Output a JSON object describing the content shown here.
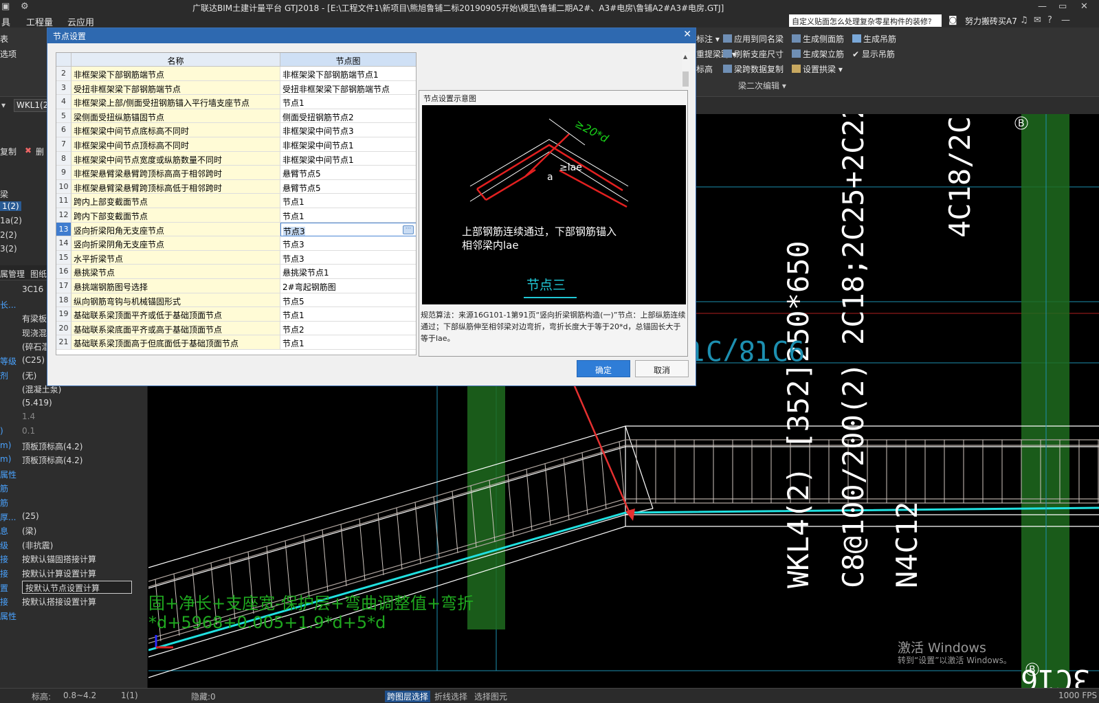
{
  "titlebar": {
    "title": "广联达BIM土建计量平台 GTJ2018 - [E:\\工程文件1\\新项目\\熊旭鲁铺二标20190905开始\\模型\\鲁铺二期A2#、A3#电房\\鲁铺A2#A3#电房.GTJ]"
  },
  "menubar": {
    "items": [
      "具",
      "工程量",
      "云应用"
    ],
    "search_text": "自定义贴面怎么处理复杂零星构件的装修?",
    "user": "努力搬砖买A7"
  },
  "ribbon": {
    "items": [
      {
        "label": "标注"
      },
      {
        "label": "应用到同名梁"
      },
      {
        "label": "生成侧面筋"
      },
      {
        "label": "生成吊筋"
      },
      {
        "label": "重提梁跨"
      },
      {
        "label": "刷新支座尺寸"
      },
      {
        "label": "生成架立筋"
      },
      {
        "label": "显示吊筋"
      },
      {
        "label": "标高"
      },
      {
        "label": "梁跨数据复制"
      },
      {
        "label": "设置拱梁"
      }
    ],
    "group_label": "梁二次编辑",
    "left_items": [
      "表",
      "选项"
    ]
  },
  "subbar": {
    "combo_value": "WKL1(2)",
    "copy_label": "复制",
    "delete_label": "删"
  },
  "leftpanel": {
    "tree": [
      {
        "label": "梁"
      },
      {
        "label": "1(2)"
      },
      {
        "label": "1a(2)"
      },
      {
        "label": "2(2)"
      },
      {
        "label": "3(2)"
      }
    ],
    "tabs": [
      "属管理",
      "图纸"
    ],
    "props": [
      {
        "key": "",
        "value": "3C16"
      },
      {
        "key": "长...",
        "value": ""
      },
      {
        "key": "",
        "value": "有梁板"
      },
      {
        "key": "",
        "value": "现浇混"
      },
      {
        "key": "",
        "value": "(碎石混"
      },
      {
        "key": "等级",
        "value": "(C25)"
      },
      {
        "key": "剂",
        "value": "(无)"
      },
      {
        "key": "",
        "value": "(混凝土泵)"
      },
      {
        "key": "",
        "value": "(5.419)"
      },
      {
        "key": "",
        "value": "1.4"
      },
      {
        "key": ")",
        "value": "0.1"
      },
      {
        "key": "m)",
        "value": "顶板顶标高(4.2)"
      },
      {
        "key": "m)",
        "value": "顶板顶标高(4.2)"
      },
      {
        "key": "属性",
        "value": ""
      },
      {
        "key": "筋",
        "value": ""
      },
      {
        "key": "筋",
        "value": ""
      },
      {
        "key": "厚...",
        "value": "(25)"
      },
      {
        "key": "息",
        "value": "(梁)"
      },
      {
        "key": "级",
        "value": "(非抗震)"
      },
      {
        "key": "接",
        "value": "按默认锚固搭接计算"
      },
      {
        "key": "接",
        "value": "按默认计算设置计算"
      },
      {
        "key": "置",
        "value": "按默认节点设置计算"
      },
      {
        "key": "接",
        "value": "按默认搭接设置计算"
      },
      {
        "key": "属性",
        "value": ""
      }
    ]
  },
  "dialog": {
    "title": "节点设置",
    "columns": [
      "名称",
      "节点图"
    ],
    "rows": [
      {
        "n": "2",
        "name": "非框架梁下部钢筋端节点",
        "node": "非框架梁下部钢筋端节点1"
      },
      {
        "n": "3",
        "name": "受扭非框架梁下部钢筋端节点",
        "node": "受扭非框架梁下部钢筋端节点"
      },
      {
        "n": "4",
        "name": "非框架梁上部/侧面受扭钢筋锚入平行墙支座节点",
        "node": "节点1"
      },
      {
        "n": "5",
        "name": "梁侧面受扭纵筋锚固节点",
        "node": "侧面受扭钢筋节点2"
      },
      {
        "n": "6",
        "name": "非框架梁中间节点底标高不同时",
        "node": "非框架梁中间节点3"
      },
      {
        "n": "7",
        "name": "非框架梁中间节点顶标高不同时",
        "node": "非框架梁中间节点1"
      },
      {
        "n": "8",
        "name": "非框架梁中间节点宽度或纵筋数量不同时",
        "node": "非框架梁中间节点1"
      },
      {
        "n": "9",
        "name": "非框架悬臂梁悬臂跨顶标高高于相邻跨时",
        "node": "悬臂节点5"
      },
      {
        "n": "10",
        "name": "非框架悬臂梁悬臂跨顶标高低于相邻跨时",
        "node": "悬臂节点5"
      },
      {
        "n": "11",
        "name": "跨内上部变截面节点",
        "node": "节点1"
      },
      {
        "n": "12",
        "name": "跨内下部变截面节点",
        "node": "节点1"
      },
      {
        "n": "13",
        "name": "竖向折梁阳角无支座节点",
        "node": "节点3"
      },
      {
        "n": "14",
        "name": "竖向折梁阴角无支座节点",
        "node": "节点3"
      },
      {
        "n": "15",
        "name": "水平折梁节点",
        "node": "节点3"
      },
      {
        "n": "16",
        "name": "悬挑梁节点",
        "node": "悬挑梁节点1"
      },
      {
        "n": "17",
        "name": "悬挑端钢筋图号选择",
        "node": "2#弯起钢筋图"
      },
      {
        "n": "18",
        "name": "纵向钢筋弯钩与机械锚固形式",
        "node": "节点5"
      },
      {
        "n": "19",
        "name": "基础联系梁顶面平齐或低于基础顶面节点",
        "node": "节点1"
      },
      {
        "n": "20",
        "name": "基础联系梁底面平齐或高于基础顶面节点",
        "node": "节点2"
      },
      {
        "n": "21",
        "name": "基础联系梁顶面高于但底面低于基础顶面节点",
        "node": "节点1"
      }
    ],
    "active_row": "13",
    "edit_button": "···",
    "preview_title": "节点设置示意图",
    "preview": {
      "dim1": "≥20*d",
      "dim2": "≥lae",
      "angle": "a",
      "caption": "上部钢筋连续通过，下部钢筋锚入",
      "caption2": "相邻梁内lae",
      "node_label": "节点三"
    },
    "description": "规范算法：来源16G101-1第91页“竖向折梁钢筋构造(一)”节点：上部纵筋连续通过；下部纵筋伸至相邻梁对边弯折，弯折长度大于等于20*d，总锚固长大于等于lae。",
    "ok": "确定",
    "cancel": "取消"
  },
  "cad": {
    "texts": {
      "t1": "4C18/2C20",
      "t2": "C8@100/200(2) 2C18;2C25+2C22",
      "t3": "WKL4(2) [352]250*650",
      "t4": "N4C12",
      "t5": "9ƆƖ8/ƆƖ6",
      "t6": "固+净长+支座宽-保护层+弯曲调整值+弯折",
      "t7": "*d+5968+0.005+1.9*d+5*d",
      "axis_b": "B",
      "bottom": "3C16"
    }
  },
  "watermark": {
    "line1": "激活 Windows",
    "line2": "转到“设置”以激活 Windows。"
  },
  "status": {
    "items": [
      "标高:",
      "0.8~4.2",
      "1(1)",
      "隐藏:0",
      "跨图层选择",
      "折线选择",
      "选择图元"
    ],
    "right": "1000 FPS"
  }
}
